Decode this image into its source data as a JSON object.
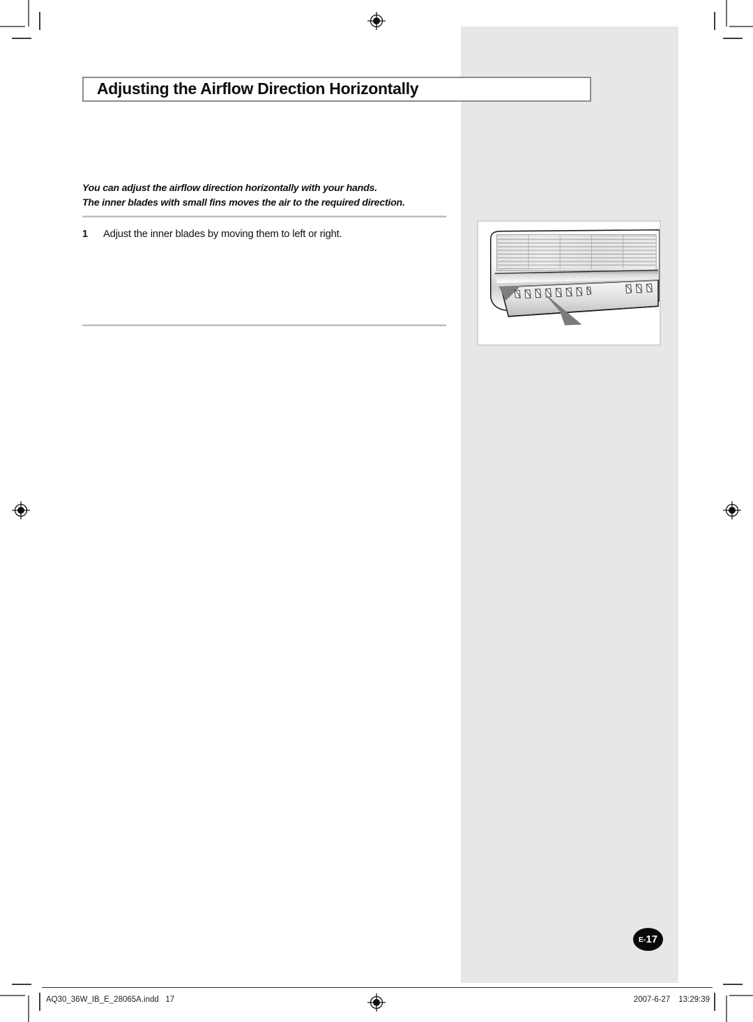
{
  "document": {
    "title": "Adjusting the Airflow Direction Horizontally",
    "lead_line_1": "You can adjust the airflow direction horizontally with your hands.",
    "lead_line_2": "The inner blades with small fins moves the air to the required direction.",
    "steps": [
      {
        "number": "1",
        "text": "Adjust the inner blades by moving them to left or right."
      }
    ],
    "page_badge": {
      "prefix": "E-",
      "number": "17"
    }
  },
  "figure": {
    "name": "air-conditioner-inner-blades-illustration",
    "caption": ""
  },
  "footer": {
    "filename": "AQ30_36W_IB_E_28065A.indd",
    "page": "17",
    "date": "2007-6-27",
    "time": "13:29:39"
  },
  "colors": {
    "tint_panel": "#e7e7e7",
    "title_border": "#8b8b8b",
    "rule": "#b4b4b4",
    "badge_background": "#0a0a0a",
    "text": "#111111"
  }
}
